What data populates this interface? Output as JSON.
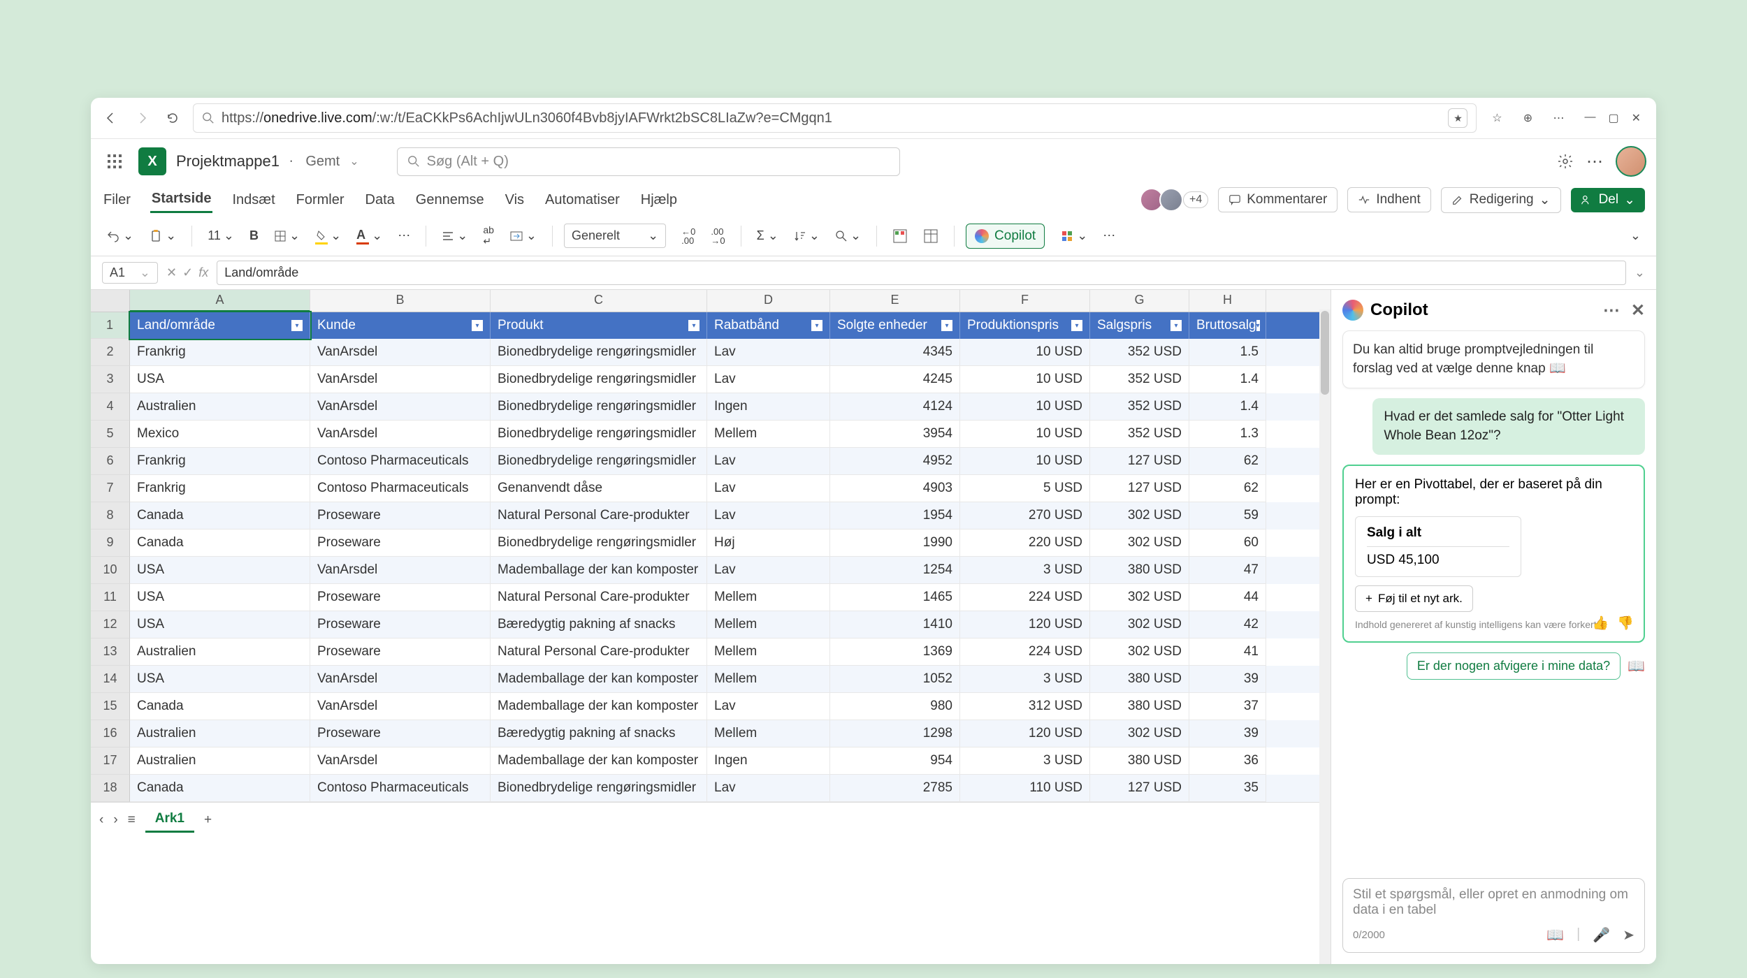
{
  "url": {
    "host": "onedrive.live.com",
    "path": "/:w:/t/EaCKkPs6AchIjwULn3060f4Bvb8jyIAFWrkt2bSC8LIaZw?e=CMgqn1"
  },
  "doc": {
    "title": "Projektmappe1",
    "status": "Gemt"
  },
  "search": {
    "placeholder": "Søg (Alt + Q)"
  },
  "tabs": [
    "Filer",
    "Startside",
    "Indsæt",
    "Formler",
    "Data",
    "Gennemse",
    "Vis",
    "Automatiser",
    "Hjælp"
  ],
  "activeTab": "Startside",
  "presence": {
    "extra": "+4"
  },
  "buttons": {
    "comments": "Kommentarer",
    "catchup": "Indhent",
    "editing": "Redigering",
    "share": "Del",
    "copilot": "Copilot"
  },
  "ribbon": {
    "fontSize": "11",
    "numberFormat": "Generelt"
  },
  "nameBox": "A1",
  "formulaBar": "Land/område",
  "columns": [
    "A",
    "B",
    "C",
    "D",
    "E",
    "F",
    "G",
    "H"
  ],
  "headers": [
    "Land/område",
    "Kunde",
    "Produkt",
    "Rabatbånd",
    "Solgte enheder",
    "Produktionspris",
    "Salgspris",
    "Bruttosalg"
  ],
  "rows": [
    {
      "n": 2,
      "c": [
        "Frankrig",
        "VanArsdel",
        "Bionedbrydelige rengøringsmidler",
        "Lav",
        "4345",
        "10 USD",
        "352 USD",
        "1.5"
      ]
    },
    {
      "n": 3,
      "c": [
        "USA",
        "VanArsdel",
        "Bionedbrydelige rengøringsmidler",
        "Lav",
        "4245",
        "10 USD",
        "352 USD",
        "1.4"
      ]
    },
    {
      "n": 4,
      "c": [
        "Australien",
        "VanArsdel",
        "Bionedbrydelige rengøringsmidler",
        "Ingen",
        "4124",
        "10 USD",
        "352 USD",
        "1.4"
      ]
    },
    {
      "n": 5,
      "c": [
        "Mexico",
        "VanArsdel",
        "Bionedbrydelige rengøringsmidler",
        "Mellem",
        "3954",
        "10 USD",
        "352 USD",
        "1.3"
      ]
    },
    {
      "n": 6,
      "c": [
        "Frankrig",
        "Contoso Pharmaceuticals",
        "Bionedbrydelige rengøringsmidler",
        "Lav",
        "4952",
        "10 USD",
        "127 USD",
        "62"
      ]
    },
    {
      "n": 7,
      "c": [
        "Frankrig",
        "Contoso Pharmaceuticals",
        "Genanvendt dåse",
        "Lav",
        "4903",
        "5 USD",
        "127 USD",
        "62"
      ]
    },
    {
      "n": 8,
      "c": [
        "Canada",
        "Proseware",
        "Natural Personal Care-produkter",
        "Lav",
        "1954",
        "270 USD",
        "302 USD",
        "59"
      ]
    },
    {
      "n": 9,
      "c": [
        "Canada",
        "Proseware",
        "Bionedbrydelige rengøringsmidler",
        "Høj",
        "1990",
        "220 USD",
        "302 USD",
        "60"
      ]
    },
    {
      "n": 10,
      "c": [
        "USA",
        "VanArsdel",
        "Mademballage der kan komposter",
        "Lav",
        "1254",
        "3 USD",
        "380 USD",
        "47"
      ]
    },
    {
      "n": 11,
      "c": [
        "USA",
        "Proseware",
        "Natural Personal Care-produkter",
        "Mellem",
        "1465",
        "224 USD",
        "302 USD",
        "44"
      ]
    },
    {
      "n": 12,
      "c": [
        "USA",
        "Proseware",
        "Bæredygtig pakning af snacks",
        "Mellem",
        "1410",
        "120 USD",
        "302 USD",
        "42"
      ]
    },
    {
      "n": 13,
      "c": [
        "Australien",
        "Proseware",
        "Natural Personal Care-produkter",
        "Mellem",
        "1369",
        "224 USD",
        "302 USD",
        "41"
      ]
    },
    {
      "n": 14,
      "c": [
        "USA",
        "VanArsdel",
        "Mademballage der kan komposter",
        "Mellem",
        "1052",
        "3 USD",
        "380 USD",
        "39"
      ]
    },
    {
      "n": 15,
      "c": [
        "Canada",
        "VanArsdel",
        "Mademballage der kan komposter",
        "Lav",
        "980",
        "312 USD",
        "380 USD",
        "37"
      ]
    },
    {
      "n": 16,
      "c": [
        "Australien",
        "Proseware",
        "Bæredygtig pakning af snacks",
        "Mellem",
        "1298",
        "120 USD",
        "302 USD",
        "39"
      ]
    },
    {
      "n": 17,
      "c": [
        "Australien",
        "VanArsdel",
        "Mademballage der kan komposter",
        "Ingen",
        "954",
        "3 USD",
        "380 USD",
        "36"
      ]
    },
    {
      "n": 18,
      "c": [
        "Canada",
        "Contoso Pharmaceuticals",
        "Bionedbrydelige rengøringsmidler",
        "Lav",
        "2785",
        "110 USD",
        "127 USD",
        "35"
      ]
    }
  ],
  "sheet": {
    "name": "Ark1"
  },
  "copilot": {
    "title": "Copilot",
    "hint": "Du kan altid bruge promptvejledningen til forslag ved at vælge denne knap 📖",
    "userMsg": "Hvad er det samlede salg for \"Otter Light Whole Bean 12oz\"?",
    "resultIntro": "Her er en Pivottabel, der er baseret på din prompt:",
    "pivot": {
      "header": "Salg i alt",
      "value": "USD 45,100"
    },
    "addSheet": "Føj til et nyt ark.",
    "disclaimer": "Indhold genereret af kunstig intelligens kan være forkert",
    "suggestion": "Er der nogen afvigere i mine data?",
    "inputPlaceholder": "Stil et spørgsmål, eller opret en anmodning om data i en tabel",
    "counter": "0/2000"
  }
}
